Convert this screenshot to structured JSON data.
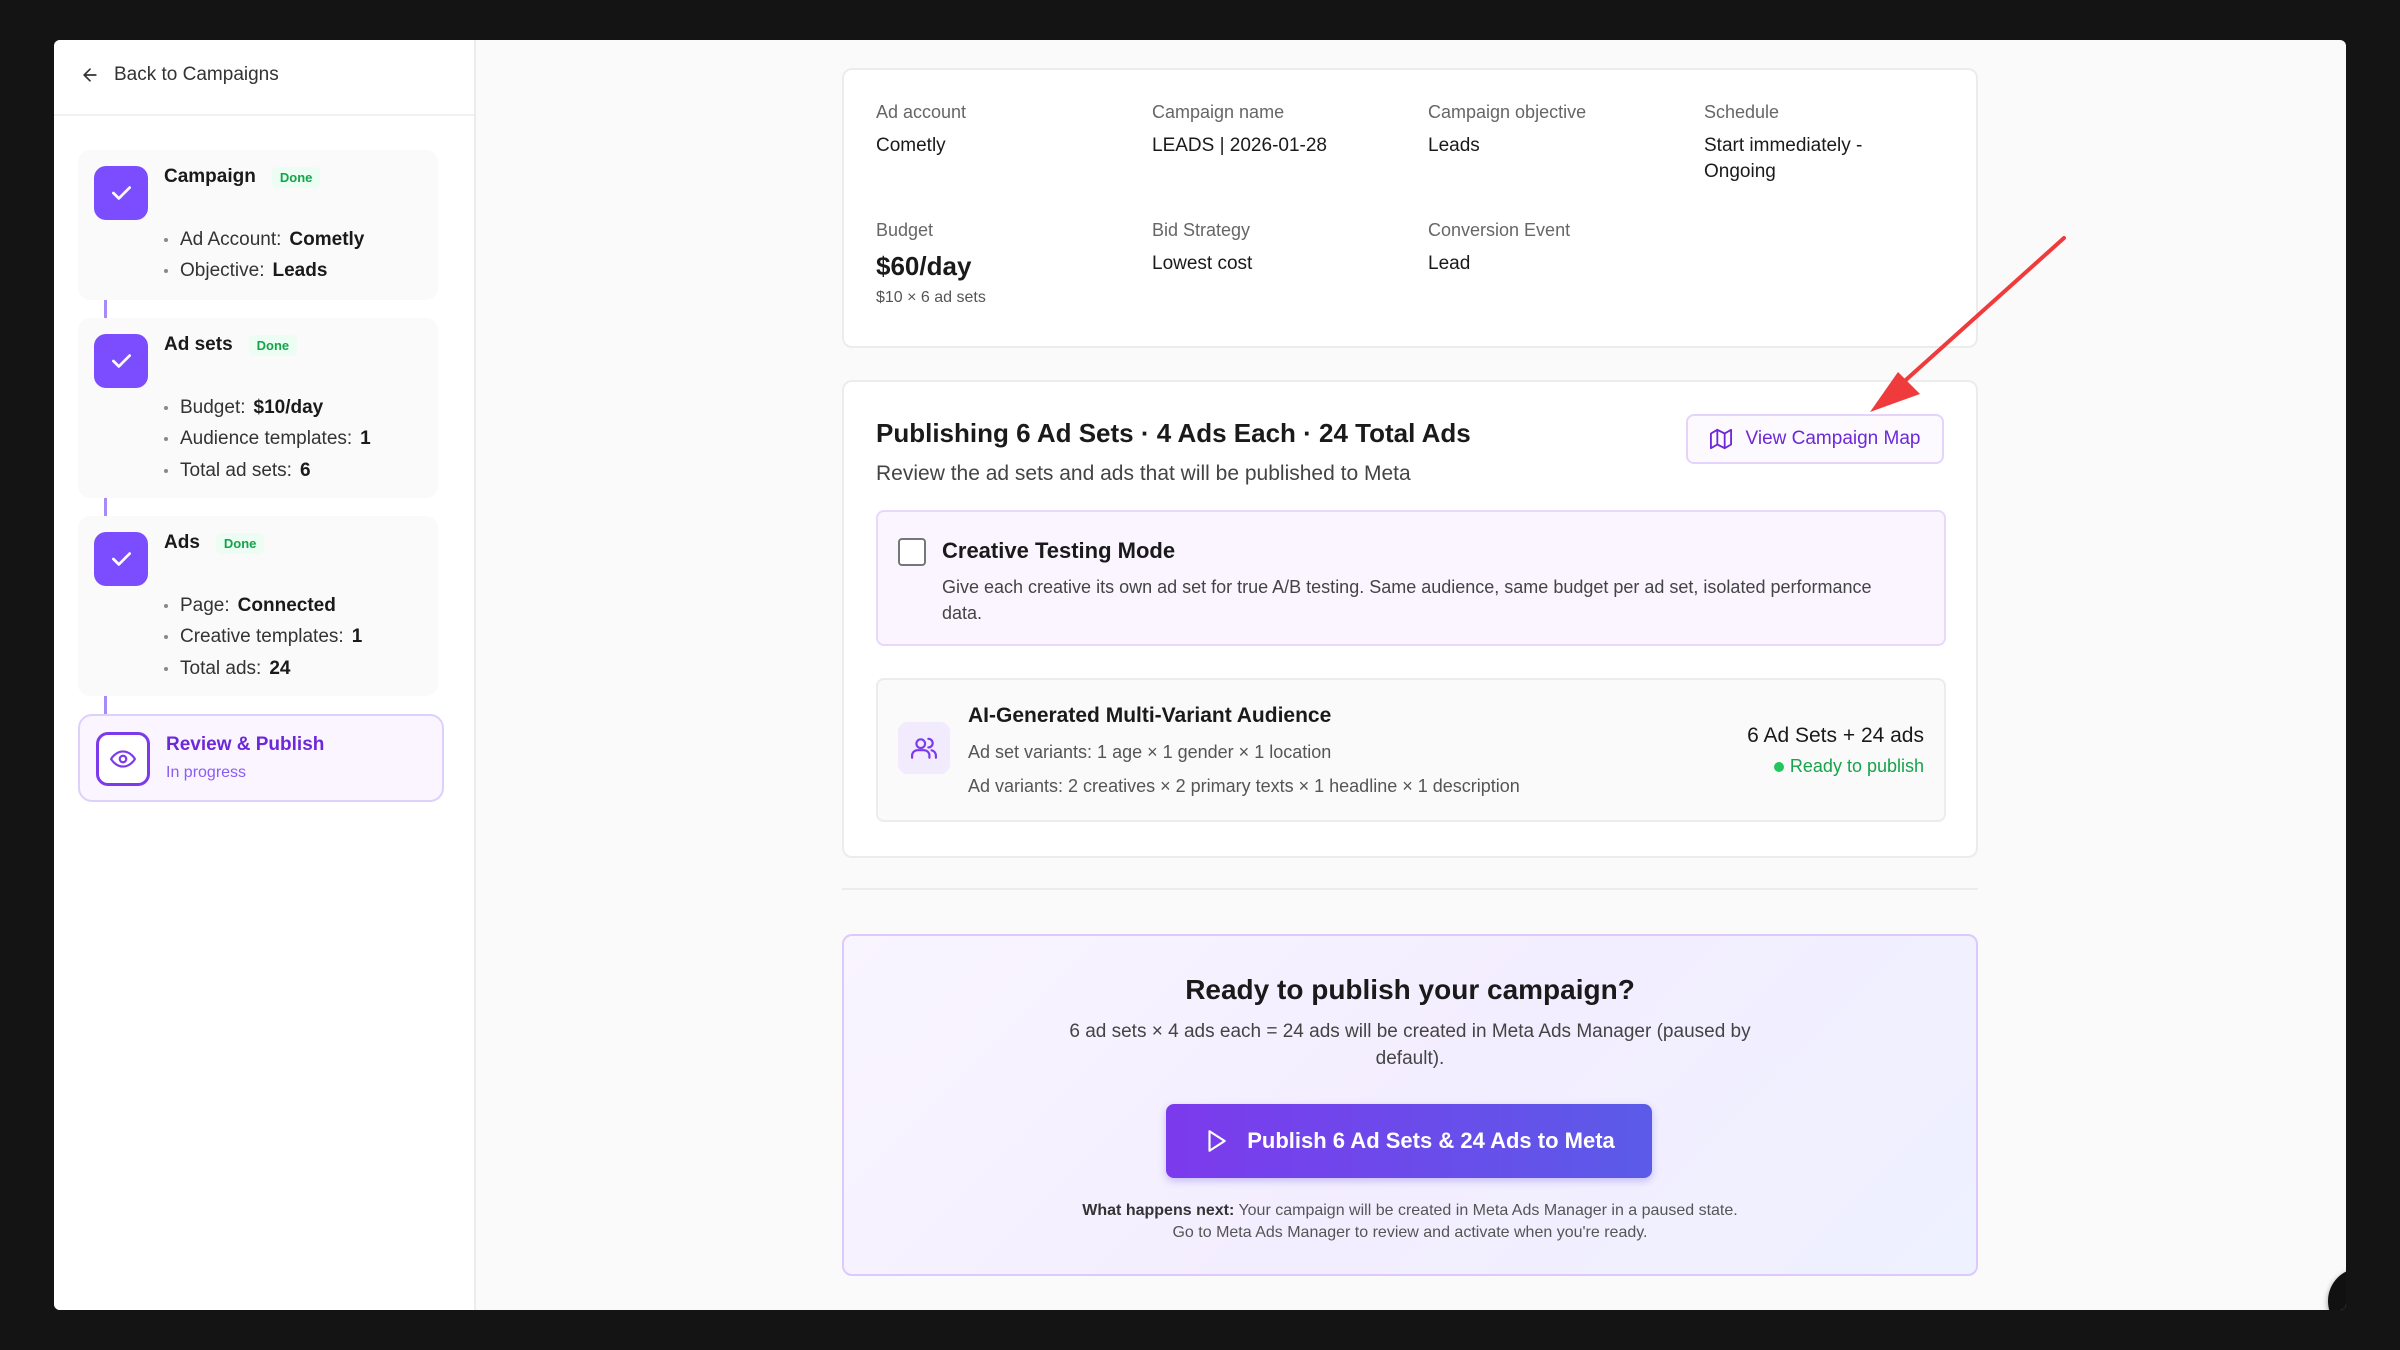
{
  "nav": {
    "back_label": "Back to Campaigns"
  },
  "steps": [
    {
      "title": "Campaign",
      "status": "Done",
      "items": [
        {
          "label": "Ad Account:",
          "value": "Cometly"
        },
        {
          "label": "Objective:",
          "value": "Leads"
        }
      ]
    },
    {
      "title": "Ad sets",
      "status": "Done",
      "items": [
        {
          "label": "Budget:",
          "value": "$10/day"
        },
        {
          "label": "Audience templates:",
          "value": "1"
        },
        {
          "label": "Total ad sets:",
          "value": "6"
        }
      ]
    },
    {
      "title": "Ads",
      "status": "Done",
      "items": [
        {
          "label": "Page:",
          "value": "Connected"
        },
        {
          "label": "Creative templates:",
          "value": "1"
        },
        {
          "label": "Total ads:",
          "value": "24"
        }
      ]
    }
  ],
  "active_step": {
    "title": "Review & Publish",
    "status": "In progress"
  },
  "summary": {
    "ad_account": {
      "label": "Ad account",
      "value": "Cometly"
    },
    "campaign_name": {
      "label": "Campaign name",
      "value": "LEADS | 2026-01-28"
    },
    "objective": {
      "label": "Campaign objective",
      "value": "Leads"
    },
    "schedule": {
      "label": "Schedule",
      "value": "Start immediately - Ongoing"
    },
    "budget": {
      "label": "Budget",
      "value": "$60/day",
      "detail": "$10 × 6 ad sets"
    },
    "bid_strategy": {
      "label": "Bid Strategy",
      "value": "Lowest cost"
    },
    "conversion_event": {
      "label": "Conversion Event",
      "value": "Lead"
    }
  },
  "publishing": {
    "title": "Publishing 6 Ad Sets · 4 Ads Each · 24 Total Ads",
    "subtitle": "Review the ad sets and ads that will be published to Meta",
    "map_button": "View Campaign Map",
    "creative_testing": {
      "title": "Creative Testing Mode",
      "description": "Give each creative its own ad set for true A/B testing. Same audience, same budget per ad set, isolated performance data.",
      "checked": false
    },
    "audience": {
      "title": "AI-Generated Multi-Variant Audience",
      "ad_set_variants": "Ad set variants: 1 age × 1 gender × 1 location",
      "ad_variants": "Ad variants: 2 creatives × 2 primary texts × 1 headline × 1 description",
      "count": "6 Ad Sets + 24 ads",
      "status": "Ready to publish"
    }
  },
  "cta": {
    "heading": "Ready to publish your campaign?",
    "text": "6 ad sets × 4 ads each = 24 ads will be created in Meta Ads Manager (paused by default).",
    "button": "Publish 6 Ad Sets & 24 Ads to Meta",
    "note_label": "What happens next:",
    "note_text": " Your campaign will be created in Meta Ads Manager in a paused state. Go to Meta Ads Manager to review and activate when you're ready."
  },
  "colors": {
    "accent": "#7c4dff",
    "success": "#16a34a",
    "annotation": "#ef3b3b"
  }
}
